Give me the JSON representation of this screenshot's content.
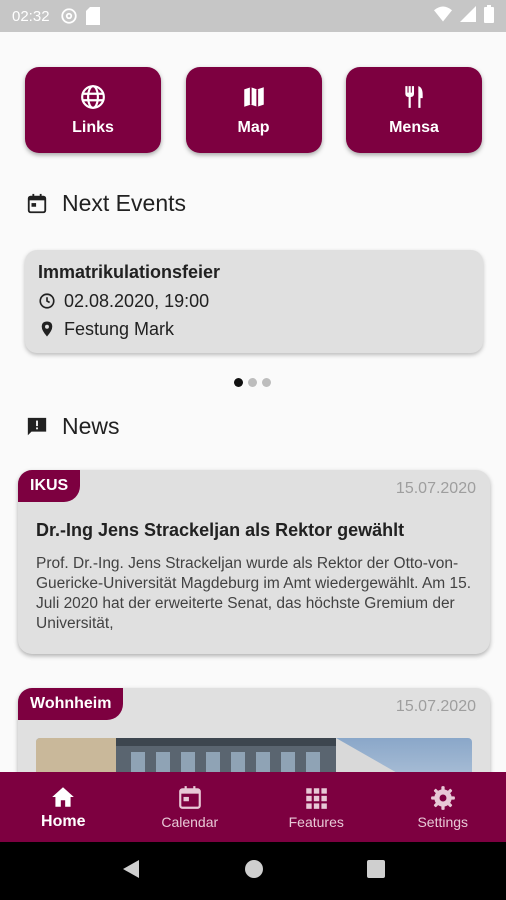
{
  "status_bar": {
    "time": "02:32",
    "icons_left": [
      "at-sign-icon",
      "sd-card-icon"
    ],
    "icons_right": [
      "wifi-icon",
      "signal-icon",
      "battery-icon"
    ]
  },
  "quick_actions": [
    {
      "label": "Links",
      "icon": "globe-icon"
    },
    {
      "label": "Map",
      "icon": "map-icon"
    },
    {
      "label": "Mensa",
      "icon": "restaurant-icon"
    }
  ],
  "events_section": {
    "title": "Next Events",
    "icon": "calendar-icon",
    "event": {
      "title": "Immatrikulationsfeier",
      "datetime": "02.08.2020, 19:00",
      "location": "Festung Mark"
    },
    "carousel": {
      "count": 3,
      "active_index": 0
    }
  },
  "news_section": {
    "title": "News",
    "icon": "announcement-icon",
    "items": [
      {
        "tag": "IKUS",
        "date": "15.07.2020",
        "title": "Dr.-Ing Jens Strackeljan als Rektor gewählt",
        "body": "Prof. Dr.-Ing. Jens Strackeljan wurde als Rektor der Otto-von-Guericke-Universität Magdeburg im Amt wiedergewählt. Am 15. Juli 2020 hat der erweiterte Senat, das höchste Gremium der Universität,"
      },
      {
        "tag": "Wohnheim",
        "date": "15.07.2020"
      }
    ]
  },
  "bottom_nav": {
    "items": [
      {
        "label": "Home",
        "icon": "home-icon",
        "active": true
      },
      {
        "label": "Calendar",
        "icon": "calendar-icon",
        "active": false
      },
      {
        "label": "Features",
        "icon": "grid-icon",
        "active": false
      },
      {
        "label": "Settings",
        "icon": "gear-icon",
        "active": false
      }
    ]
  },
  "system_nav": [
    "back-icon",
    "home-circle-icon",
    "recents-icon"
  ],
  "colors": {
    "brand": "#7d0040",
    "card": "#e0e0e0",
    "background": "#fafafa"
  }
}
